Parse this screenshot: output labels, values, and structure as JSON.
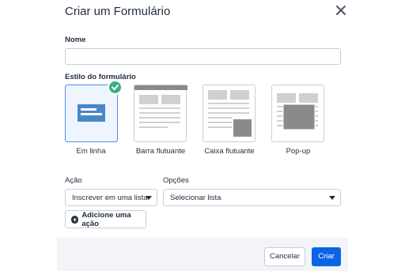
{
  "dialog": {
    "title": "Criar um Formulário"
  },
  "name_field": {
    "label": "Nome",
    "value": "",
    "placeholder": ""
  },
  "form_style": {
    "label": "Estilo do formulário",
    "selected": "Em linha",
    "options": [
      {
        "label": "Em linha"
      },
      {
        "label": "Barra flutuante"
      },
      {
        "label": "Caixa flutuante"
      },
      {
        "label": "Pop-up"
      }
    ]
  },
  "action": {
    "label": "Ação",
    "value": "Inscrever em uma lista"
  },
  "options_field": {
    "label": "Opções",
    "value": "Selecionar lista"
  },
  "add_action": {
    "label": "Adicione uma ação"
  },
  "footer": {
    "cancel_label": "Cancelar",
    "create_label": "Criar"
  },
  "colors": {
    "accent": "#0b63e5",
    "selected_border": "#4a90e2",
    "check": "#35b37e"
  },
  "icons": {
    "close": "close-icon",
    "check": "check-icon",
    "plus": "plus-circle-icon",
    "caret": "caret-down-icon"
  }
}
